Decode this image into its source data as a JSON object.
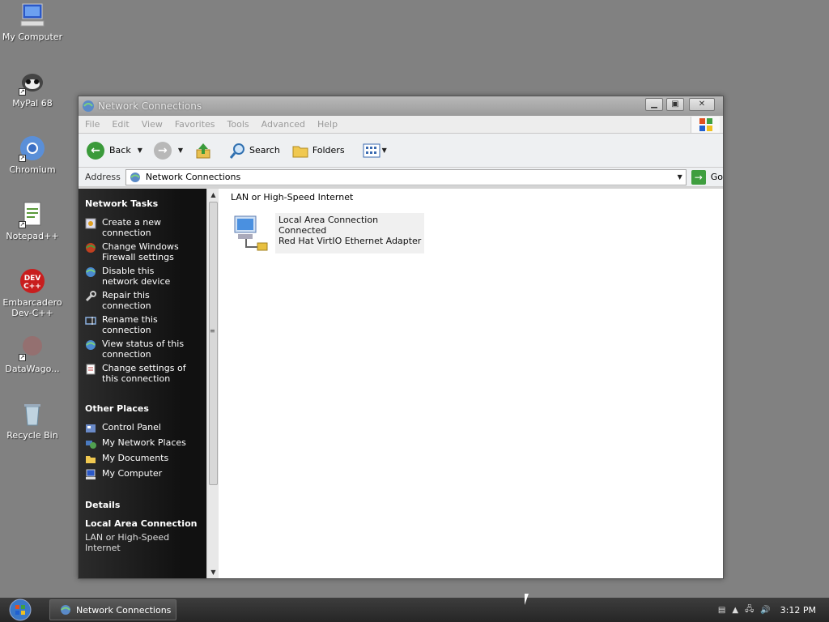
{
  "desktop": {
    "icons": [
      {
        "label": "My Computer"
      },
      {
        "label": "MyPal 68"
      },
      {
        "label": "Chromium"
      },
      {
        "label": "Notepad++"
      },
      {
        "label": "Embarcadero\nDev-C++"
      },
      {
        "label": "DataWago..."
      },
      {
        "label": "Recycle Bin"
      }
    ]
  },
  "window": {
    "title": "Network Connections",
    "menu": [
      "File",
      "Edit",
      "View",
      "Favorites",
      "Tools",
      "Advanced",
      "Help"
    ],
    "toolbar": {
      "back_label": "Back",
      "search_label": "Search",
      "folders_label": "Folders"
    },
    "address": {
      "label": "Address",
      "value": "Network Connections",
      "go_label": "Go"
    },
    "taskpane": {
      "network_tasks_title": "Network Tasks",
      "network_tasks": [
        "Create a new connection",
        "Change Windows Firewall settings",
        "Disable this network device",
        "Repair this connection",
        "Rename this connection",
        "View status of this connection",
        "Change settings of this connection"
      ],
      "other_places_title": "Other Places",
      "other_places": [
        "Control Panel",
        "My Network Places",
        "My Documents",
        "My Computer"
      ],
      "details_title": "Details",
      "details_name": "Local Area Connection",
      "details_type": "LAN or High-Speed Internet"
    },
    "main": {
      "group_header": "LAN or High-Speed Internet",
      "connection": {
        "name": "Local Area Connection",
        "status": "Connected",
        "device": "Red Hat VirtIO Ethernet Adapter"
      }
    }
  },
  "taskbar": {
    "task_label": "Network Connections",
    "clock": "3:12 PM"
  }
}
